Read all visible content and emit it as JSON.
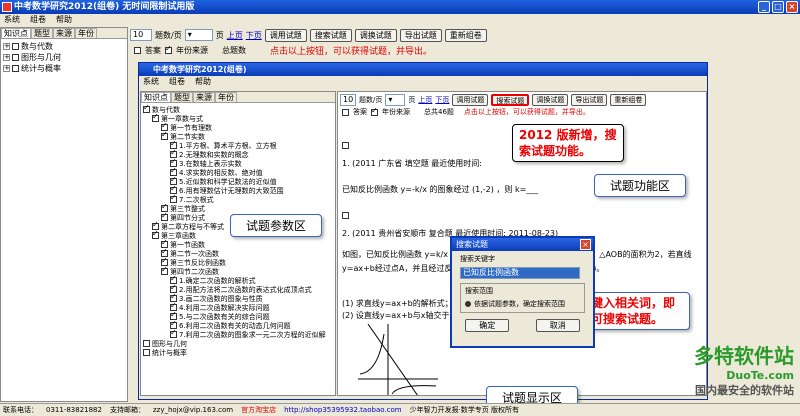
{
  "window": {
    "title": "中考数学研究2012(组卷)  无时间限制试用版"
  },
  "menu": [
    "系统",
    "组卷",
    "帮助"
  ],
  "left_tabs": [
    "知识点",
    "题型",
    "来源",
    "年份"
  ],
  "left_tree": [
    "数与代数",
    "图形与几何",
    "统计与概率"
  ],
  "toolbar": {
    "per_page_value": "10",
    "per_page_label": "题数/页",
    "page_label": "页",
    "prev": "上页",
    "next": "下页",
    "buttons": [
      "调用试题",
      "搜索试题",
      "调换试题",
      "导出试题",
      "重新组卷"
    ]
  },
  "row2": {
    "answer": "答案",
    "year_all": "年份来源",
    "total": "总题数",
    "hint": "点击以上按钮，可以获得试题，并导出。"
  },
  "inner": {
    "title": "中考数学研究2012(组卷)",
    "menu": [
      "系统",
      "组卷",
      "帮助"
    ],
    "tabs": [
      "知识点",
      "题型",
      "来源",
      "年份"
    ],
    "tree": [
      "数与代数",
      "第一章数与式",
      "第一节有理数",
      "第二节实数",
      "1.平方根、算术平方根、立方根",
      "2.无理数和实数的概念",
      "3.在数轴上表示实数",
      "4.求实数的相反数、绝对值",
      "5.近似数和科学记数法的近似值",
      "6.用有理数估计无理数的大致范围",
      "7.二次根式",
      "第三节整式",
      "第四节分式",
      "第二章方程与不等式",
      "第三章函数",
      "第一节函数",
      "第二节一次函数",
      "第三节反比例函数",
      "第四节二次函数",
      "1.确定二次函数的解析式",
      "2.用配方法将二次函数的表达式化成顶点式",
      "3.画二次函数的图象与性质",
      "4.利用二次函数解决实际问题",
      "5.与二次函数有关的综合问题",
      "6.利用二次函数有关的动态几何问题",
      "7.利用二次函数的图象求一元二次方程的近似解",
      "图形与几何",
      "统计与概率"
    ],
    "toolbar": {
      "per_page_value": "10",
      "per_page_label": "题数/页",
      "page_label": "页",
      "prev": "上页",
      "next": "下页"
    },
    "row2": {
      "answer": "答案",
      "year": "年份来源",
      "total": "总共46题",
      "hint": "点击以上按钮，可以获得试题，并导出。"
    },
    "q1": {
      "header": "1. (2011  广东省  填空题  最近使用时间:",
      "body": "已知反比例函数 y=-k/x 的图象经过 (1,-2) ，则 k=___"
    },
    "q2": {
      "header": "2. (2011  贵州省安顺市  复合题  最近使用时间:  2011-08-23)",
      "body": "如图，已知反比例函数 y=k/x 的图象经过点A(-1, m)，AB⊥x轴于点B，△AOB的面积为2，若直线y=ax+b经过点A，并且经过反比例函数 y=k/x 的图象上另一点C(n,-2)。",
      "s1": "(1) 求直线y=ax+b的解析式；",
      "s2": "(2) 设直线y=ax+b与x轴交于点M，求AM的长。"
    }
  },
  "callouts": {
    "new": "2012 版新增，搜索试题功能。",
    "func": "试题功能区",
    "params": "试题参数区",
    "input": "键入相关词，即可搜索试题。",
    "display": "试题显示区"
  },
  "dialog": {
    "title": "搜索试题",
    "keyword_label": "搜索关键字",
    "keyword_value": "已知反比例函数",
    "scope_label": "搜索范围",
    "scope_option": "依据试题参数，确定搜索范围",
    "ok": "确定",
    "cancel": "取消"
  },
  "status": {
    "phone_label": "联系电话：",
    "phone": "0311-83821882",
    "email_label": "支持邮箱：",
    "email": "zzy_hojx@vip.163.com",
    "shop_label": "官方淘宝店",
    "shop_url": "http://shop35395932.taobao.com",
    "slogan": "少年智力开发报·数学专页  版权所有"
  },
  "watermark": {
    "brand": "多特软件站",
    "url": "DuoTe.com",
    "tagline": "国内最安全的软件站"
  }
}
